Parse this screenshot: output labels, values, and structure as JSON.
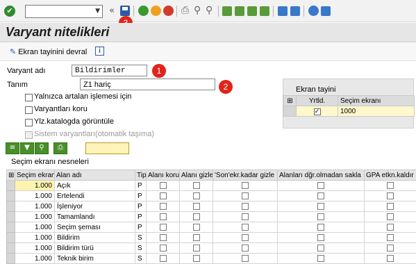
{
  "toolbar": {
    "command_field": "",
    "back_arrows": "«"
  },
  "badges": [
    "1",
    "2",
    "3"
  ],
  "title": "Varyant nitelikleri",
  "app_toolbar": {
    "screen_assign_label": "Ekran tayinini devral",
    "info_label": "i"
  },
  "form": {
    "variant_name_label": "Varyant adı",
    "variant_name_value": "Bildirimler",
    "description_label": "Tanım",
    "description_value": "Z1 hariç",
    "checkboxes": [
      {
        "label": "Yalnızca artalan işlemesi için",
        "checked": false,
        "disabled": false
      },
      {
        "label": "Varyantları koru",
        "checked": false,
        "disabled": false
      },
      {
        "label": "Ylz.katalogda görüntüle",
        "checked": false,
        "disabled": false
      },
      {
        "label": "Sistem varyantları(otomatik taşıma)",
        "checked": false,
        "disabled": true
      }
    ]
  },
  "screen_panel": {
    "title": "Ekran tayini",
    "headers": [
      "Yrtld.",
      "Seçim ekranı"
    ],
    "row": {
      "created": true,
      "screen": "1000"
    }
  },
  "section_label": "Seçim ekranı   nesneleri",
  "grid": {
    "headers": [
      "Seçim ekranı",
      "Alan adı",
      "Tip",
      "Alanı koru",
      "Alanı gizle",
      "'Son'ekr.kadar gizle",
      "Alanları dğr.olmadan sakla",
      "GPA etkn.kaldır"
    ],
    "rows": [
      {
        "screen": "1.000",
        "field": "Açık",
        "type": "P"
      },
      {
        "screen": "1.000",
        "field": "Ertelendi",
        "type": "P"
      },
      {
        "screen": "1.000",
        "field": "İşleniyor",
        "type": "P"
      },
      {
        "screen": "1.000",
        "field": "Tamamlandı",
        "type": "P"
      },
      {
        "screen": "1.000",
        "field": "Seçim şeması",
        "type": "P"
      },
      {
        "screen": "1.000",
        "field": "Bildirim",
        "type": "S"
      },
      {
        "screen": "1.000",
        "field": "Bildirim türü",
        "type": "S"
      },
      {
        "screen": "1.000",
        "field": "Teknik birim",
        "type": "S"
      }
    ]
  }
}
